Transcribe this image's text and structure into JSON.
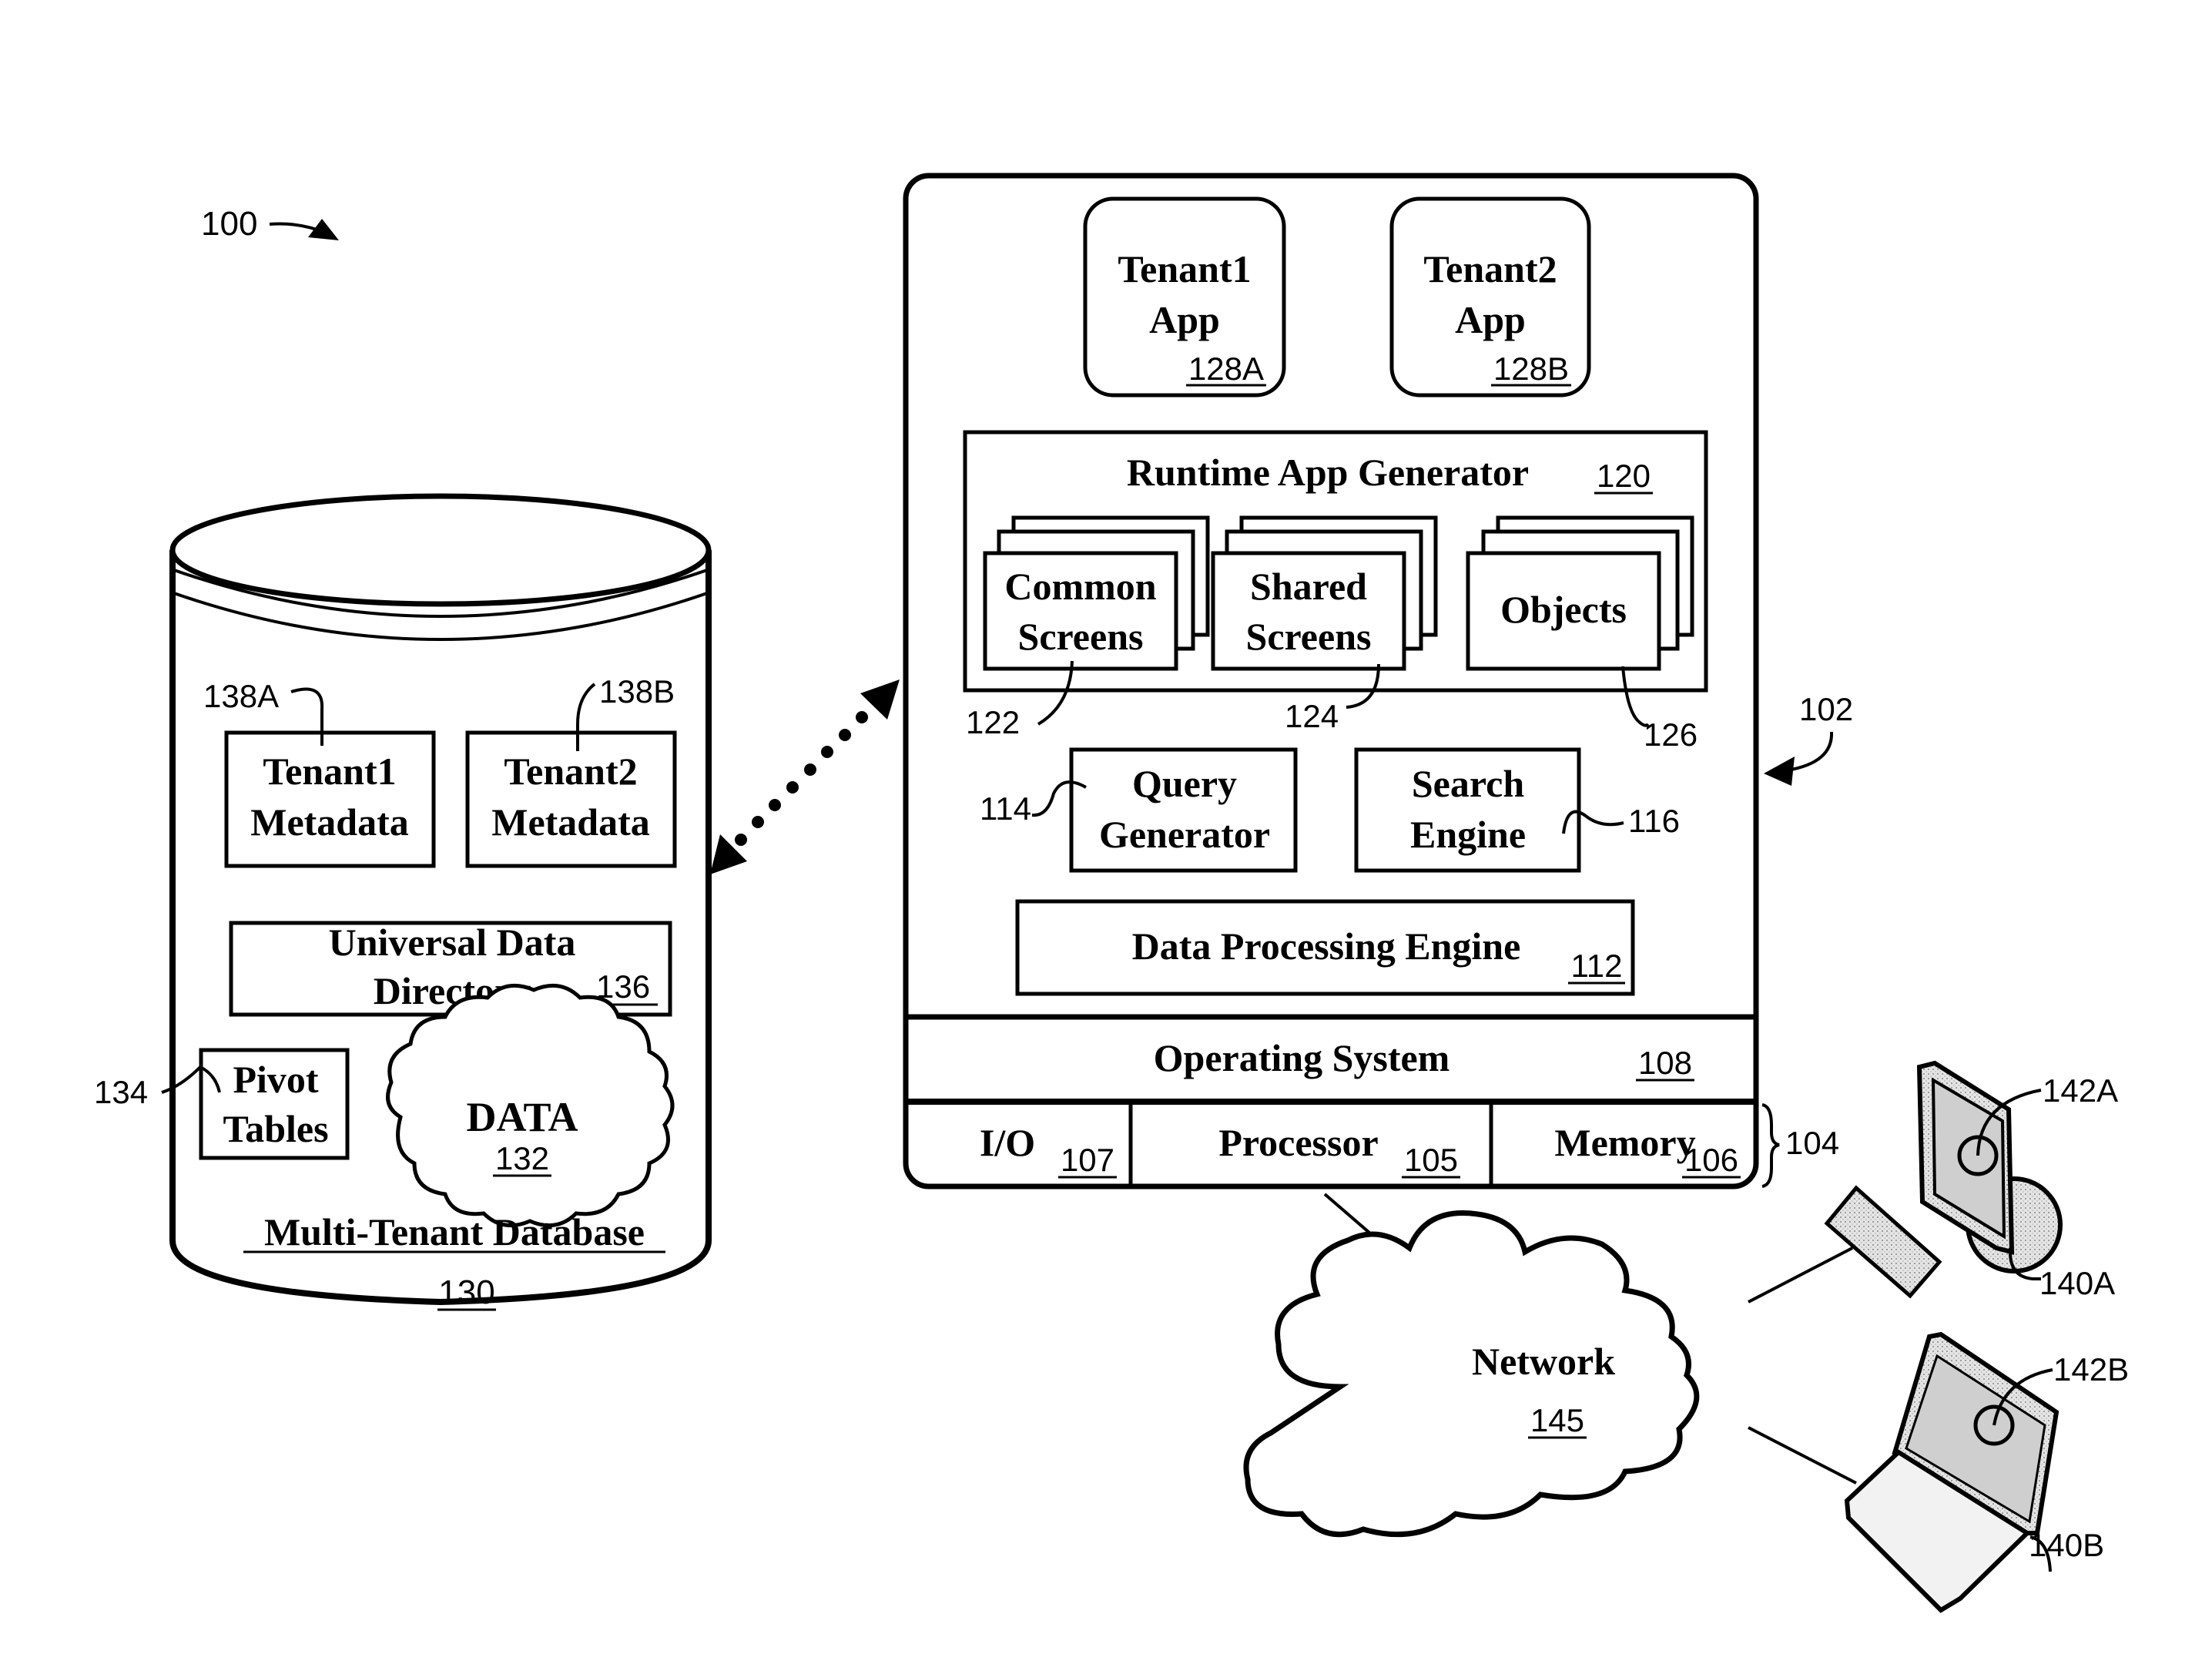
{
  "figure_ref": "100",
  "database": {
    "title": "Multi-Tenant Database",
    "ref": "130",
    "tenant1_metadata": {
      "line1": "Tenant1",
      "line2": "Metadata",
      "ref": "138A"
    },
    "tenant2_metadata": {
      "line1": "Tenant2",
      "line2": "Metadata",
      "ref": "138B"
    },
    "universal_directory": {
      "line1": "Universal Data",
      "line2": "Directory",
      "ref": "136"
    },
    "pivot_tables": {
      "line1": "Pivot",
      "line2": "Tables",
      "ref": "134"
    },
    "data_cloud": {
      "label": "DATA",
      "ref": "132"
    }
  },
  "server": {
    "ref": "102",
    "tenant1_app": {
      "line1": "Tenant1",
      "line2": "App",
      "ref": "128A"
    },
    "tenant2_app": {
      "line1": "Tenant2",
      "line2": "App",
      "ref": "128B"
    },
    "runtime_generator": {
      "title": "Runtime App Generator",
      "ref": "120"
    },
    "common_screens": {
      "line1": "Common",
      "line2": "Screens",
      "ref": "122"
    },
    "shared_screens": {
      "line1": "Shared",
      "line2": "Screens",
      "ref": "124"
    },
    "objects": {
      "label": "Objects",
      "ref": "126"
    },
    "query_generator": {
      "line1": "Query",
      "line2": "Generator",
      "ref": "114"
    },
    "search_engine": {
      "line1": "Search",
      "line2": "Engine",
      "ref": "116"
    },
    "data_processing_engine": {
      "label": "Data Processing Engine",
      "ref": "112"
    },
    "operating_system": {
      "label": "Operating System",
      "ref": "108"
    },
    "hardware_ref": "104",
    "io": {
      "label": "I/O",
      "ref": "107"
    },
    "processor": {
      "label": "Processor",
      "ref": "105"
    },
    "memory": {
      "label": "Memory",
      "ref": "106"
    }
  },
  "network": {
    "label": "Network",
    "ref": "145"
  },
  "clients": {
    "desktop": {
      "device_ref": "140A",
      "app_ref": "142A"
    },
    "laptop": {
      "device_ref": "140B",
      "app_ref": "142B"
    }
  }
}
